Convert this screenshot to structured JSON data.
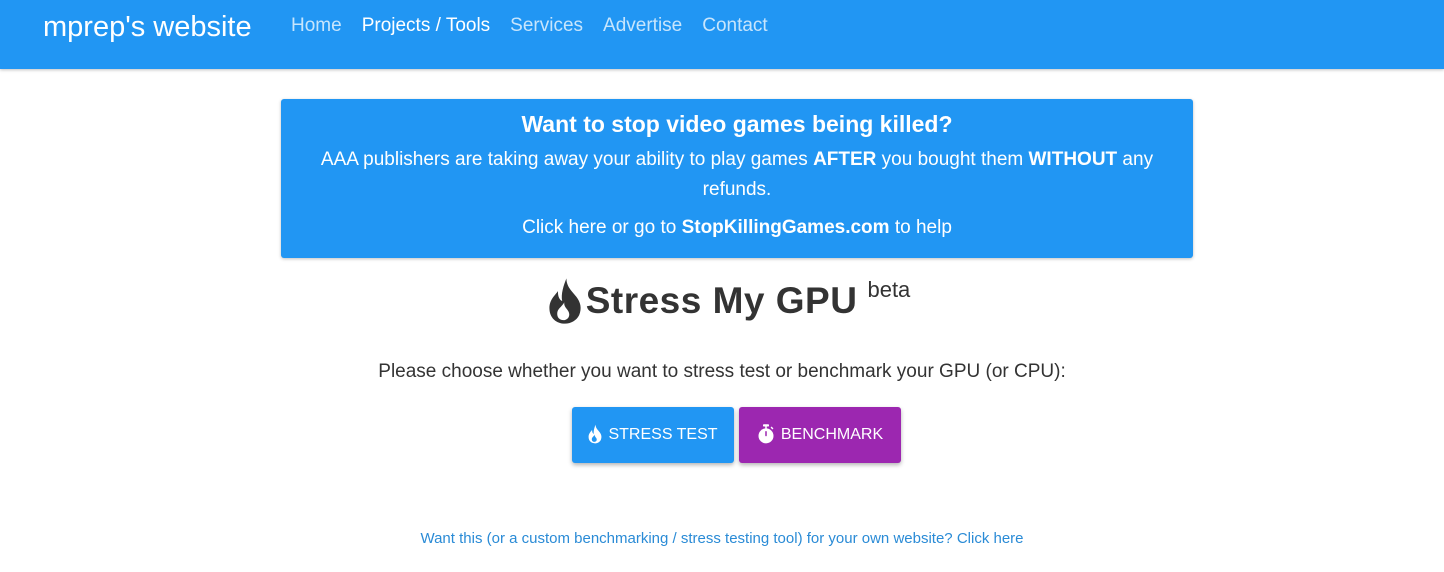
{
  "navbar": {
    "brand": "mprep's website",
    "links": [
      "Home",
      "Projects / Tools",
      "Services",
      "Advertise",
      "Contact"
    ],
    "active_index": 1
  },
  "banner": {
    "title": "Want to stop video games being killed?",
    "text_part1": "AAA publishers are taking away your ability to play games ",
    "text_bold1": "AFTER",
    "text_part2": " you bought them ",
    "text_bold2": "WITHOUT",
    "text_part3": " any refunds.",
    "cta_part1": "Click here or go to ",
    "cta_link": "StopKillingGames.com",
    "cta_part2": " to help"
  },
  "page": {
    "title": "Stress My GPU",
    "badge": "beta",
    "title_icon": "flame-icon",
    "instruction": "Please choose whether you want to stress test or benchmark your GPU (or CPU):"
  },
  "buttons": {
    "stress_label": "STRESS TEST",
    "stress_icon": "flame-icon",
    "benchmark_label": "BENCHMARK",
    "benchmark_icon": "stopwatch-icon"
  },
  "footer": {
    "link_text": "Want this (or a custom benchmarking / stress testing tool) for your own website? Click here"
  },
  "colors": {
    "primary": "#2196f3",
    "purple": "#9c27b0",
    "link": "#2a8bd6",
    "text": "#333333"
  }
}
